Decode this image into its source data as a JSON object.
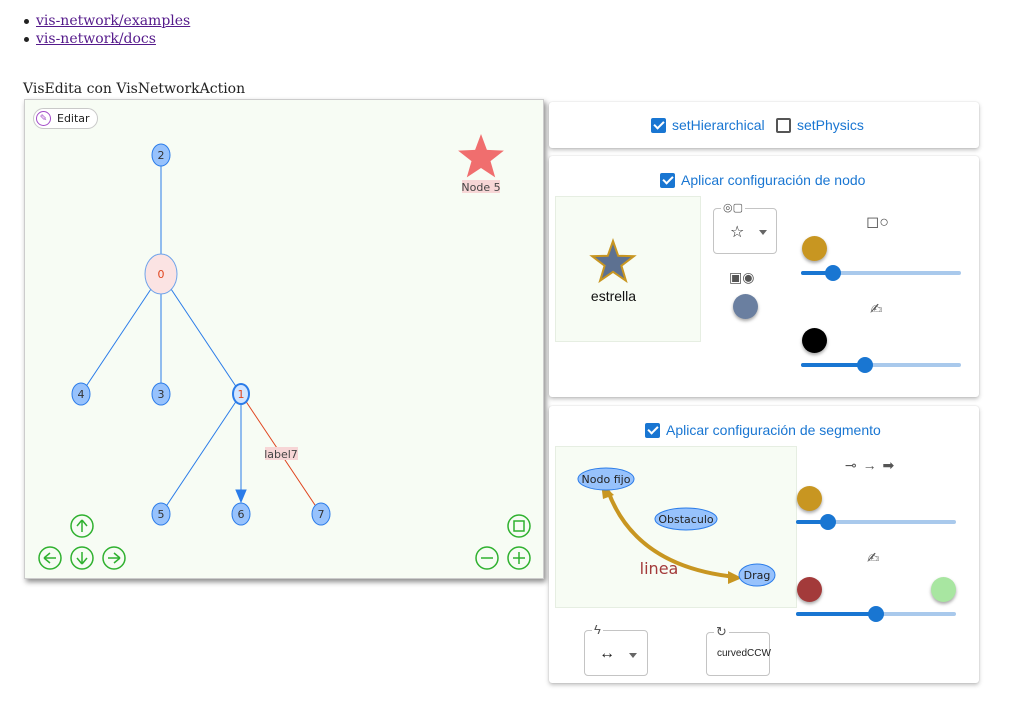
{
  "links": [
    {
      "label": "vis-network/examples"
    },
    {
      "label": "vis-network/docs"
    }
  ],
  "heading": "VisEdita con VisNetworkAction",
  "network": {
    "edit_button": "Editar",
    "nodes": [
      {
        "id": "2",
        "label": "2"
      },
      {
        "id": "0",
        "label": "0"
      },
      {
        "id": "4",
        "label": "4"
      },
      {
        "id": "3",
        "label": "3"
      },
      {
        "id": "1",
        "label": "1"
      },
      {
        "id": "5",
        "label": "5"
      },
      {
        "id": "6",
        "label": "6"
      },
      {
        "id": "7",
        "label": "7"
      },
      {
        "id": "node5",
        "label": "Node 5"
      }
    ],
    "edge_label": "label7",
    "colors": {
      "node": "#97c2fc",
      "node_border": "#2b7ce9",
      "selected_node": "#fbe3e3",
      "edge": "#2b7ce9",
      "edge_red": "#e0451f",
      "nav": "#2fb12f",
      "star": "#f06e6e"
    }
  },
  "physics_card": {
    "hierarchical": {
      "label": "setHierarchical",
      "checked": true
    },
    "physics": {
      "label": "setPhysics",
      "checked": false
    }
  },
  "node_card": {
    "title": "Aplicar configuración de nodo",
    "checked": true,
    "preview_label": "estrella",
    "shape_icon": "shape-icon",
    "shape_value": "☆",
    "border_icons": "■◉",
    "size_icon": "□○",
    "font_icon": "✍",
    "colors": {
      "fill": "#c89621",
      "node": "#6a7fa0",
      "font": "#000000",
      "star_fill": "#5d7191",
      "star_border": "#c89621"
    },
    "size_slider": 0.2,
    "font_slider": 0.4
  },
  "edge_card": {
    "title": "Aplicar configuración de segmento",
    "checked": true,
    "preview": {
      "fixed": "Nodo fijo",
      "obstacle": "Obstaculo",
      "drag": "Drag",
      "edge": "linea"
    },
    "arrows_icon": "⊸ → ➡",
    "font_icon": "✍",
    "dashes_icon": "ϟ",
    "direction_value": "↔",
    "smooth_icon": "↻",
    "smooth_value": "curvedCCW",
    "colors": {
      "edge": "#c89621",
      "font": "#a33a3a",
      "font_bg": "#a8e6a1"
    },
    "width_slider": 0.2,
    "font_slider": 0.5
  }
}
